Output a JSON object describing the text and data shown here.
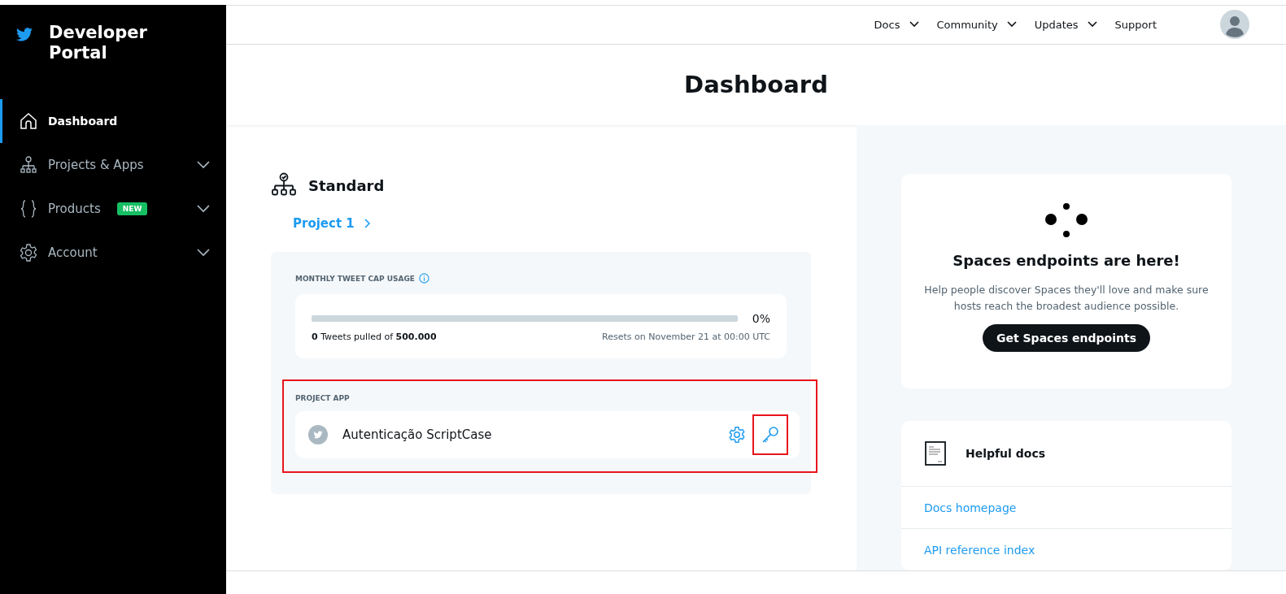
{
  "sidebar": {
    "logo_text": "Developer Portal",
    "items": [
      {
        "label": "Dashboard",
        "selected": true,
        "expandable": false
      },
      {
        "label": "Projects & Apps",
        "selected": false,
        "expandable": true
      },
      {
        "label": "Products",
        "selected": false,
        "expandable": true,
        "badge": "NEW"
      },
      {
        "label": "Account",
        "selected": false,
        "expandable": true
      }
    ]
  },
  "top_nav": [
    {
      "label": "Docs",
      "dropdown": true
    },
    {
      "label": "Community",
      "dropdown": true
    },
    {
      "label": "Updates",
      "dropdown": true
    },
    {
      "label": "Support",
      "dropdown": false
    }
  ],
  "page_title": "Dashboard",
  "project_section": {
    "title": "Standard",
    "project_link": "Project 1",
    "usage": {
      "label": "MONTHLY TWEET CAP USAGE",
      "level": 0,
      "percent": "0%",
      "count": "0",
      "pulled_text": " Tweets pulled of ",
      "cap": "500.000",
      "reset": "Resets on November 21 at 00:00 UTC"
    },
    "app": {
      "label": "PROJECT APP",
      "name": "Autenticação ScriptCase"
    }
  },
  "spaces_card": {
    "title": "Spaces endpoints are here!",
    "text": "Help people discover Spaces they'll love and make sure hosts reach the broadest audience possible.",
    "button": "Get Spaces endpoints"
  },
  "docs_card": {
    "title": "Helpful docs",
    "links": [
      "Docs homepage",
      "API reference index"
    ]
  }
}
